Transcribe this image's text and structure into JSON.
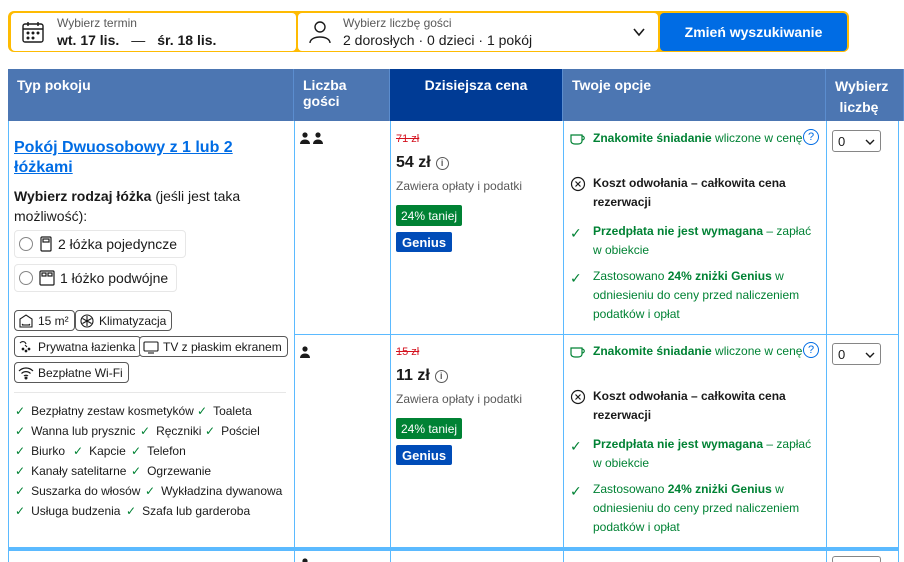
{
  "search": {
    "dates_label": "Wybierz termin",
    "checkin": "wt. 17 lis.",
    "dash": "—",
    "checkout": "śr. 18 lis.",
    "guests_label": "Wybierz liczbę gości",
    "guests_value": "2 dorosłych · 0 dzieci · 1 pokój",
    "button": "Zmień wyszukiwanie",
    "colors": {
      "frame": "#febb02",
      "button": "#006ce4"
    }
  },
  "table": {
    "headers": {
      "room_type": "Typ pokoju",
      "guests": "Liczba gości",
      "price": "Dzisiejsza cena",
      "options": "Twoje opcje",
      "select": "Wybierz liczbę"
    },
    "colors": {
      "header": "#4c76b2",
      "header_today": "#003b95",
      "border": "#5bbaff"
    }
  },
  "room": {
    "name": "Pokój Dwuosobowy z 1 lub 2 łóżkami",
    "bed_choice_bold": "Wybierz rodzaj łóżka",
    "bed_choice_rest": " (jeśli jest taka możliwość):",
    "bed_options": [
      "2 łóżka pojedyncze",
      "1 łóżko podwójne"
    ],
    "chips": [
      "15 m²",
      "Klimatyzacja",
      "Prywatna łazienka",
      "TV z płaskim ekranem",
      "Bezpłatne Wi-Fi"
    ],
    "facilities": [
      "Bezpłatny zestaw kosmetyków",
      "Toaleta",
      "Wanna lub prysznic",
      "Ręczniki",
      "Pościel",
      "Biurko",
      "Kapcie",
      "Telefon",
      "Kanały satelitarne",
      "Ogrzewanie",
      "Suszarka do włosów",
      "Wykładzina dywanowa",
      "Usługa budzenia",
      "Szafa lub garderoba"
    ]
  },
  "offers": [
    {
      "persons": 2,
      "old_price": "71 zł",
      "price": "54 zł",
      "taxes": "Zawiera opłaty i podatki",
      "discount": "24% taniej",
      "genius": "Genius",
      "opt_breakfast_bold": "Znakomite śniadanie",
      "opt_breakfast_rest": " wliczone w cenę",
      "opt_cancel": "Koszt odwołania – całkowita cena rezerwacji",
      "opt_prepay_bold": "Przedpłata nie jest wymagana",
      "opt_prepay_rest": " – zapłać w obiekcie",
      "opt_genius_pre": "Zastosowano ",
      "opt_genius_bold": "24% zniżki Genius",
      "opt_genius_rest": " w odniesieniu do ceny przed naliczeniem podatków i opłat",
      "qty": "0"
    },
    {
      "persons": 1,
      "old_price": "15 zł",
      "price": "11 zł",
      "taxes": "Zawiera opłaty i podatki",
      "discount": "24% taniej",
      "genius": "Genius",
      "opt_breakfast_bold": "Znakomite śniadanie",
      "opt_breakfast_rest": " wliczone w cenę",
      "opt_cancel": "Koszt odwołania – całkowita cena rezerwacji",
      "opt_prepay_bold": "Przedpłata nie jest wymagana",
      "opt_prepay_rest": " – zapłać w obiekcie",
      "opt_genius_pre": "Zastosowano ",
      "opt_genius_bold": "24% zniżki Genius",
      "opt_genius_rest": " w odniesieniu do ceny przed naliczeniem podatków i opłat",
      "qty": "0"
    }
  ],
  "icons": {
    "calendar": "calendar-icon",
    "person": "person-icon",
    "chevron": "chevron-down-icon",
    "info": "info-icon",
    "help": "help-icon",
    "coffee": "coffee-cup-icon",
    "cancel": "cancel-clock-icon",
    "check": "check-icon"
  }
}
